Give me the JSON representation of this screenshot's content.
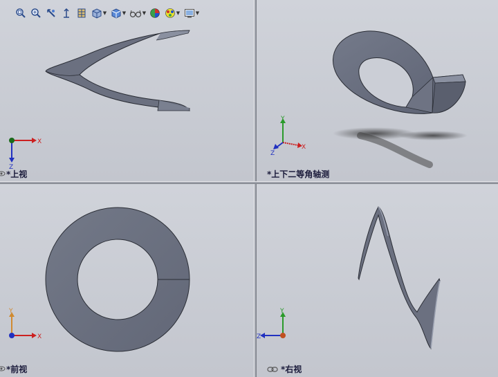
{
  "viewports": {
    "top": {
      "label": "*上视"
    },
    "iso": {
      "label": "*上下二等角轴测"
    },
    "front": {
      "label": "*前视"
    },
    "right": {
      "label": "*右视"
    }
  },
  "axes": {
    "x": "X",
    "y": "Y",
    "z": "Z"
  },
  "toolbar": {
    "items": [
      "zoom-to-fit-icon",
      "zoom-to-area-icon",
      "previous-view-icon",
      "section-view-icon",
      "view-orientation-icon",
      "display-style-icon",
      "hide-show-items-icon",
      "edit-appearance-icon",
      "apply-scene-icon",
      "view-settings-icon"
    ]
  },
  "colors": {
    "part": "#6b7080",
    "part_edge": "#2a2d35",
    "axis_x": "#cc2020",
    "axis_y": "#2a9a2a",
    "axis_z": "#2030c0",
    "axis_origin": "#1a6a1a"
  }
}
